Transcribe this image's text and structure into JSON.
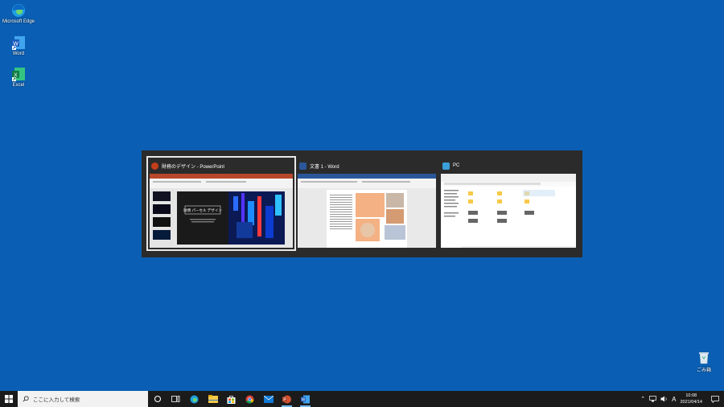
{
  "desktop": {
    "icons": [
      {
        "label": "Microsoft Edge"
      },
      {
        "label": "Word"
      },
      {
        "label": "Excel"
      },
      {
        "label": "ごみ箱"
      }
    ]
  },
  "switcher": {
    "windows": [
      {
        "title": "財務のデザイン - PowerPoint",
        "app": "powerpoint",
        "selected": true,
        "slide_title": "財務 パーセル デザイン"
      },
      {
        "title": "文書 1 - Word",
        "app": "word",
        "selected": false
      },
      {
        "title": "PC",
        "app": "explorer",
        "selected": false
      }
    ]
  },
  "taskbar": {
    "search_placeholder": "ここに入力して検索",
    "pinned": [
      "cortana-icon",
      "task-view-icon",
      "edge-icon",
      "file-explorer-icon",
      "store-icon",
      "chrome-icon",
      "mail-icon",
      "powerpoint-icon",
      "word-icon"
    ],
    "ime": "A",
    "time": "10:08",
    "date": "2021/04/14"
  },
  "colors": {
    "desktop": "#0a5fb4",
    "taskbar": "#1b1b1b",
    "switcher": "#2b2b2b",
    "powerpoint": "#c43e1c",
    "word": "#2b579a",
    "excel": "#217346"
  }
}
